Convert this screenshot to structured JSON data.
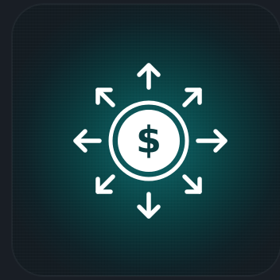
{
  "app_icon": {
    "icon": "dollar-distribution-icon",
    "coin_icon": "dollar-coin-icon",
    "arrows_icon": "arrows-outward-icon",
    "colors": {
      "background": "#191e25",
      "tile_center": "#0e6466",
      "tile_edge": "#141c22",
      "glyph": "#ffffff"
    }
  }
}
